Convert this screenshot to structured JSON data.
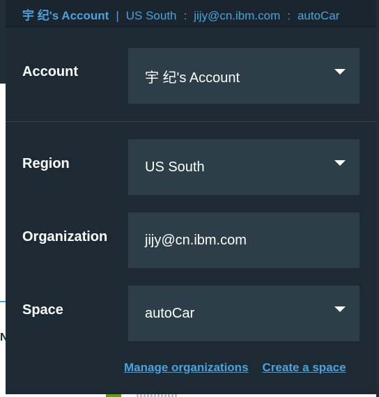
{
  "header": {
    "account": "宇 纪's Account",
    "separator": "|",
    "region": "US South",
    "colon_1": ":",
    "organization": "jijy@cn.ibm.com",
    "colon_2": ":",
    "space": "autoCar"
  },
  "form": {
    "account": {
      "label": "Account",
      "value": "宇 纪's Account",
      "icon": "caret-down-icon"
    },
    "region": {
      "label": "Region",
      "value": "US South",
      "icon": "caret-down-icon"
    },
    "organization": {
      "label": "Organization",
      "value": "jijy@cn.ibm.com"
    },
    "space": {
      "label": "Space",
      "value": "autoCar",
      "icon": "caret-down-icon"
    }
  },
  "links": {
    "manage_organizations": "Manage organizations",
    "create_space": "Create a space"
  },
  "background": {
    "edge_letter": "N"
  },
  "colors": {
    "panel": "#1d2a33",
    "field": "#2d3e48",
    "accent": "#4aa3df"
  }
}
